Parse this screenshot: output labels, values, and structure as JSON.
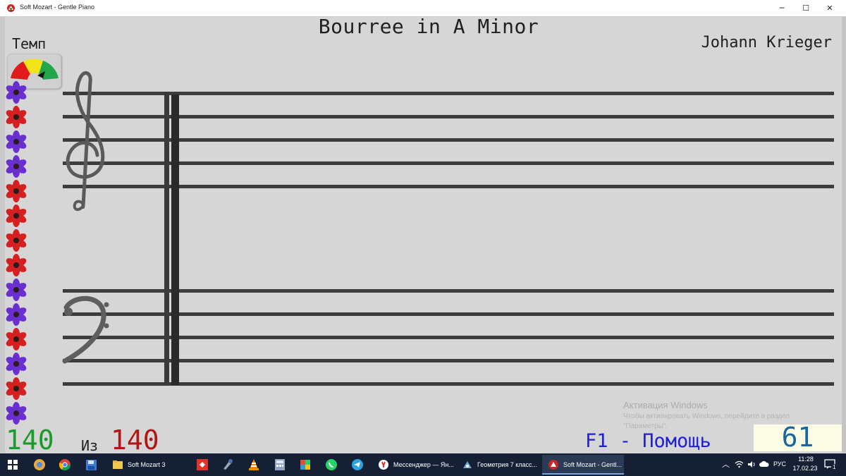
{
  "window": {
    "title": "Soft Mozart - Gentle Piano",
    "minimize_glyph": "─",
    "maximize_glyph": "☐",
    "close_glyph": "✕"
  },
  "score": {
    "title": "Bourree in A Minor",
    "composer": "Johann Krieger",
    "tempo_label": "Темп"
  },
  "flowers": [
    "purple",
    "red",
    "purple",
    "purple",
    "red",
    "red",
    "red",
    "red",
    "purple",
    "purple",
    "red",
    "purple",
    "red",
    "purple"
  ],
  "status": {
    "current": "140",
    "of_label": "Из",
    "total": "140",
    "help": "F1 - Помощь",
    "score_value": "61"
  },
  "watermark": {
    "line1": "Активация Windows",
    "line2": "Чтобы активировать Windows, перейдите в раздел",
    "line3": "\"Параметры\"."
  },
  "taskbar": {
    "apps": [
      {
        "label": "Soft Mozart 3",
        "icon": "folder-icon"
      },
      {
        "label": "Мессенджер — Ян...",
        "icon": "yandex-icon"
      },
      {
        "label": "Геометрия 7 класс...",
        "icon": "geometry-app-icon"
      },
      {
        "label": "Soft Mozart - Gentl...",
        "icon": "soft-mozart-icon",
        "active": true
      }
    ],
    "language": "РУС",
    "time": "11:28",
    "date": "17.02.23",
    "notification_count": "1"
  },
  "colors": {
    "flower_red": "#d42020",
    "flower_purple": "#6a2fd0",
    "current_green": "#1b9a2e",
    "total_red": "#b01818",
    "help_blue": "#1f1fd6",
    "score_blue": "#17679a"
  }
}
